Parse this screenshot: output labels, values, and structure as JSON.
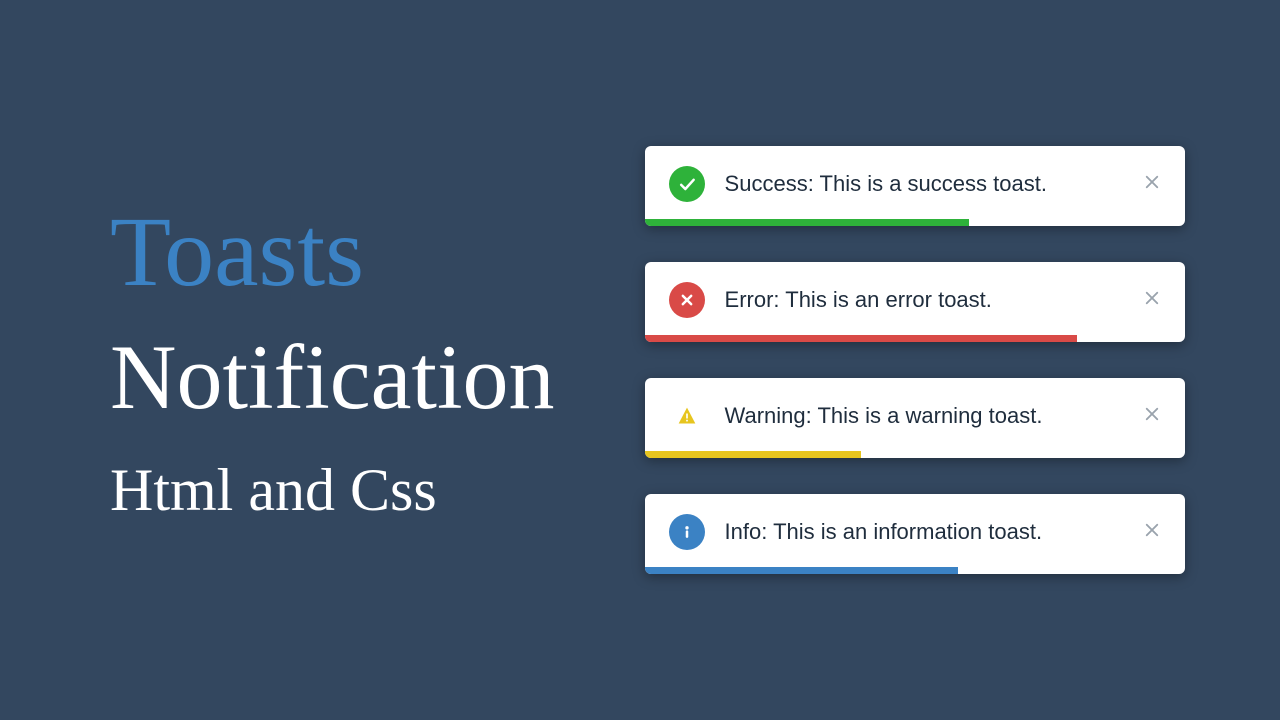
{
  "title": {
    "line1": "Toasts",
    "line2": "Notification",
    "line3": "Html and Css"
  },
  "toasts": [
    {
      "type": "success",
      "message": "Success: This is a success toast.",
      "icon_name": "check-circle-icon",
      "progress_pct": 60
    },
    {
      "type": "error",
      "message": "Error: This is an error toast.",
      "icon_name": "x-circle-icon",
      "progress_pct": 80
    },
    {
      "type": "warning",
      "message": "Warning: This is a warning toast.",
      "icon_name": "warning-triangle-icon",
      "progress_pct": 40
    },
    {
      "type": "info",
      "message": "Info: This is an information toast.",
      "icon_name": "info-circle-icon",
      "progress_pct": 58
    }
  ],
  "colors": {
    "background": "#33475f",
    "accent_blue": "#3b82c4",
    "success": "#2eb23a",
    "error": "#d94a47",
    "warning": "#e7c51f",
    "info": "#3b82c4"
  }
}
